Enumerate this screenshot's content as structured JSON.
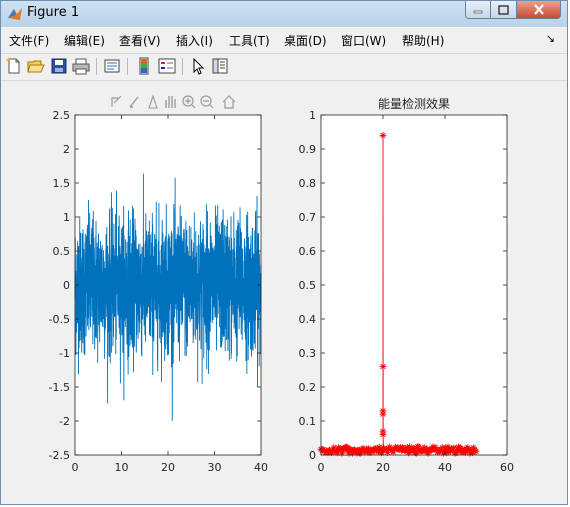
{
  "window": {
    "title": "Figure 1"
  },
  "menu": {
    "items": [
      "文件(F)",
      "编辑(E)",
      "查看(V)",
      "插入(I)",
      "工具(T)",
      "桌面(D)",
      "窗口(W)",
      "帮助(H)"
    ],
    "arrow": "↘"
  },
  "toolbar": {
    "icons": [
      "new-figure-icon",
      "open-file-icon",
      "save-icon",
      "print-icon",
      "link-plot-icon",
      "colorbar-icon",
      "legend-icon",
      "pointer-icon",
      "property-inspector-icon"
    ]
  },
  "axes_toolbar": {
    "icons": [
      "export-icon",
      "brush-icon",
      "data-cursor-icon",
      "pan-icon",
      "zoom-in-icon",
      "zoom-out-icon",
      "home-icon"
    ]
  },
  "colors": {
    "signal": "#0072bd",
    "energy": "#ff0000"
  },
  "chart_data": [
    {
      "type": "line",
      "title": "",
      "xlabel": "",
      "ylabel": "",
      "xlim": [
        0,
        40
      ],
      "ylim": [
        -2.5,
        2.5
      ],
      "xticks": [
        "0",
        "10",
        "20",
        "30",
        "40"
      ],
      "yticks": [
        "-2.5",
        "-2",
        "-1.5",
        "-1",
        "-0.5",
        "0",
        "0.5",
        "1",
        "1.5",
        "2",
        "2.5"
      ],
      "series": [
        {
          "approx_noise": {
            "samples": 2000,
            "std": 0.5,
            "min": -2.0,
            "max": 2.05
          }
        }
      ]
    },
    {
      "type": "line",
      "title": "能量检测效果",
      "xlabel": "",
      "ylabel": "",
      "xlim": [
        0,
        60
      ],
      "ylim": [
        0,
        1
      ],
      "xticks": [
        "0",
        "20",
        "40",
        "60"
      ],
      "yticks": [
        "0",
        "0.1",
        "0.2",
        "0.3",
        "0.4",
        "0.5",
        "0.6",
        "0.7",
        "0.8",
        "0.9",
        "1"
      ],
      "marker": "*",
      "series": [
        {
          "peak": [
            {
              "x": 20,
              "y": 0.94
            },
            {
              "x": 20,
              "y": 0.26
            },
            {
              "x": 20,
              "y": 0.13
            },
            {
              "x": 20,
              "y": 0.12
            },
            {
              "x": 20,
              "y": 0.07
            },
            {
              "x": 20,
              "y": 0.06
            }
          ],
          "baseline": {
            "x_start": 0,
            "x_end": 50,
            "count": 400,
            "y_min": 0.005,
            "y_max": 0.025
          }
        }
      ]
    }
  ]
}
